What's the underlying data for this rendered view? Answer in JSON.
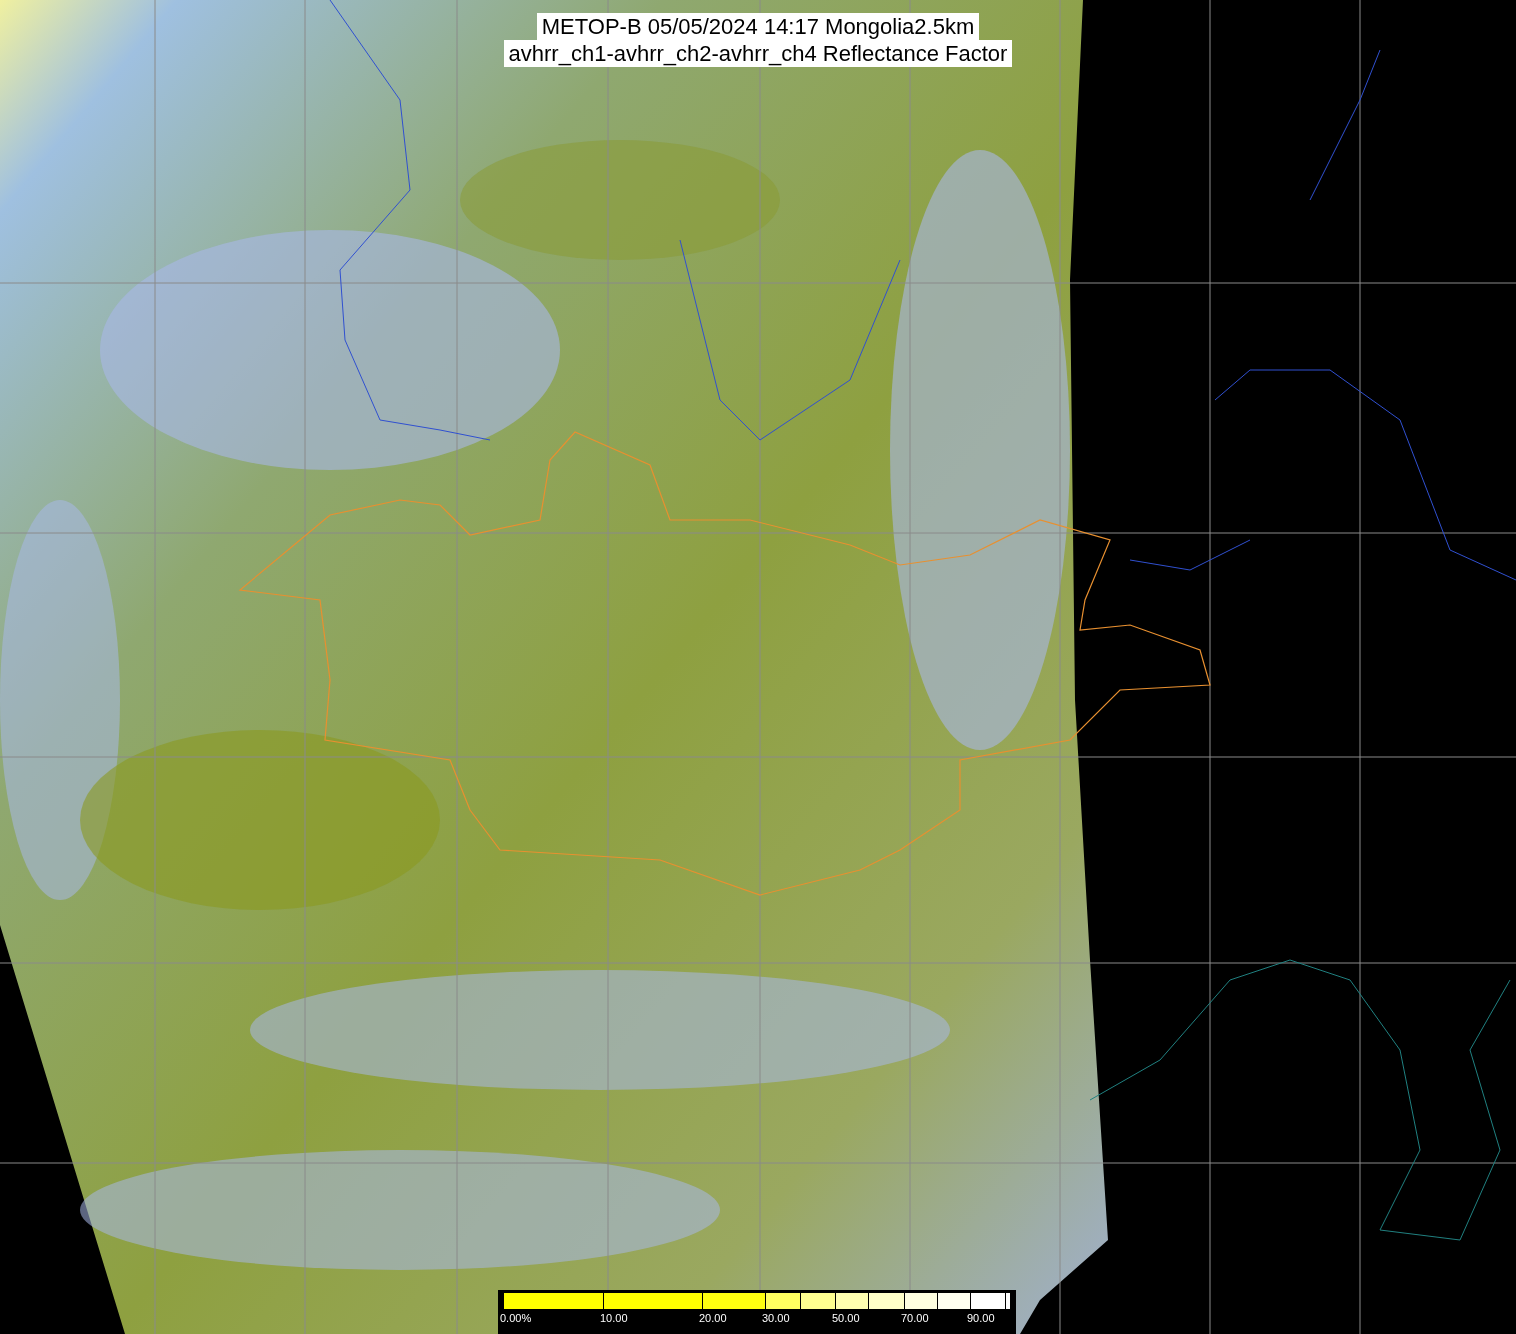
{
  "title": {
    "lines": [
      "METOP-B 05/05/2024 14:17 Mongolia2.5km",
      "avhrr_ch1-avhrr_ch2-avhrr_ch4 Reflectance Factor"
    ]
  },
  "colorbar": {
    "segments": [
      {
        "color": "#ffff00",
        "label": "0.00%"
      },
      {
        "color": "#ffff00",
        "label": "10.00"
      },
      {
        "color": "#ffff10",
        "label": "20.00"
      },
      {
        "color": "#ffff60",
        "label": "30.00"
      },
      {
        "color": "#ffff90"
      },
      {
        "color": "#ffffb0",
        "label": "50.00"
      },
      {
        "color": "#ffffc8"
      },
      {
        "color": "#ffffe0",
        "label": "70.00"
      },
      {
        "color": "#fffff0"
      },
      {
        "color": "#ffffff",
        "label": "90.00"
      },
      {
        "color": "#ffffff"
      }
    ]
  }
}
